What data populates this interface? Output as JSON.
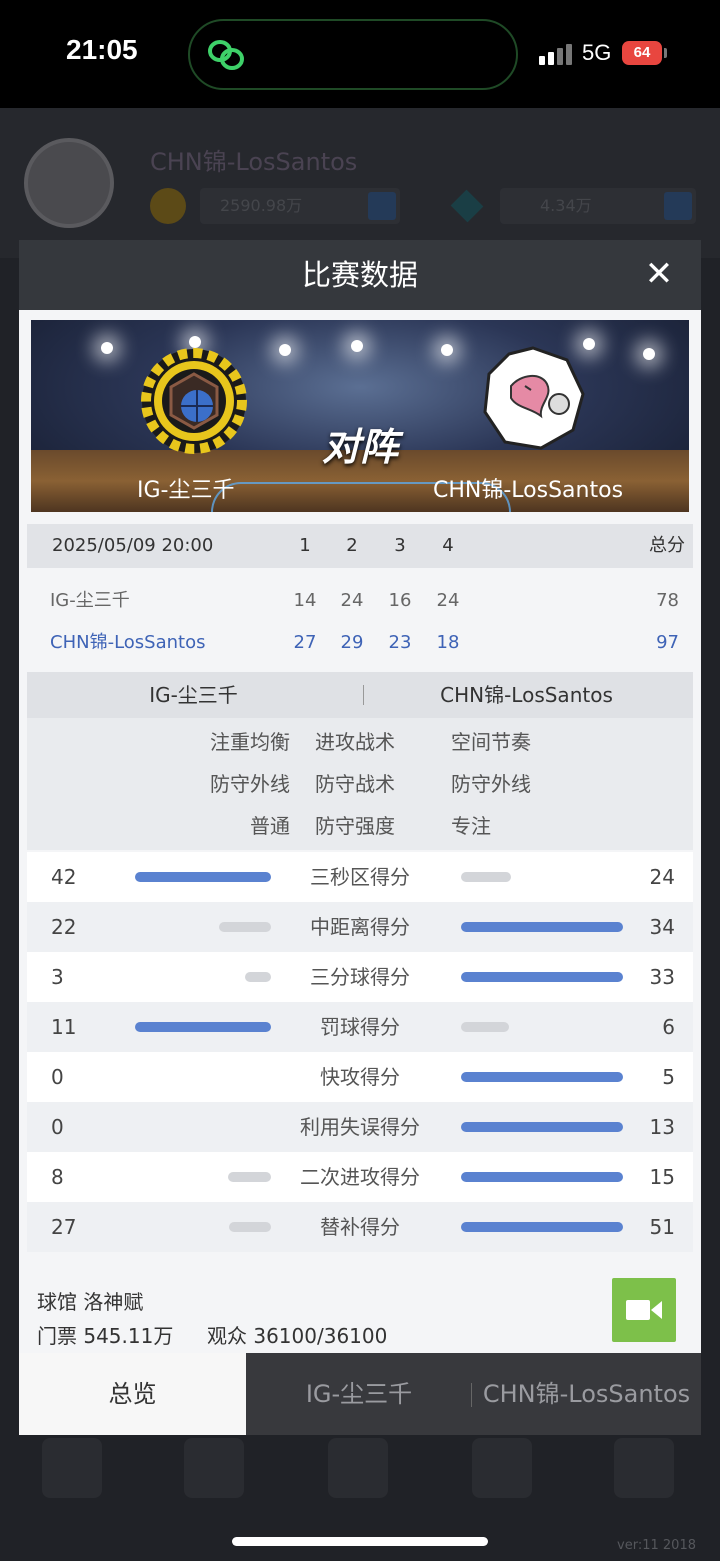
{
  "status_bar": {
    "time": "21:05",
    "network": "5G",
    "battery": "64"
  },
  "background": {
    "player_name": "CHN锦-LosSantos",
    "coins": "2590.98万",
    "gems": "4.34万",
    "version": "ver:11  2018"
  },
  "modal": {
    "title": "比赛数据",
    "close_icon": "close-icon",
    "banner": {
      "team_left": "IG-尘三千",
      "team_right": "CHN锦-LosSantos",
      "vs_text": "对阵"
    },
    "score_table": {
      "date": "2025/05/09 20:00",
      "quarter_labels": [
        "1",
        "2",
        "3",
        "4"
      ],
      "total_label": "总分",
      "rows": [
        {
          "team": "IG-尘三千",
          "quarters": [
            "14",
            "24",
            "16",
            "24"
          ],
          "total": "78"
        },
        {
          "team": "CHN锦-LosSantos",
          "quarters": [
            "27",
            "29",
            "23",
            "18"
          ],
          "total": "97"
        }
      ]
    },
    "tactics": {
      "team_left": "IG-尘三千",
      "team_right": "CHN锦-LosSantos",
      "rows": [
        [
          "注重均衡",
          "进攻战术",
          "空间节奏"
        ],
        [
          "防守外线",
          "防守战术",
          "防守外线"
        ],
        [
          "普通",
          "防守强度",
          "专注"
        ]
      ]
    },
    "stats": [
      {
        "label": "三秒区得分",
        "left": "42",
        "right": "24"
      },
      {
        "label": "中距离得分",
        "left": "22",
        "right": "34"
      },
      {
        "label": "三分球得分",
        "left": "3",
        "right": "33"
      },
      {
        "label": "罚球得分",
        "left": "11",
        "right": "6"
      },
      {
        "label": "快攻得分",
        "left": "0",
        "right": "5"
      },
      {
        "label": "利用失误得分",
        "left": "0",
        "right": "13"
      },
      {
        "label": "二次进攻得分",
        "left": "8",
        "right": "15"
      },
      {
        "label": "替补得分",
        "left": "27",
        "right": "51"
      }
    ],
    "venue": {
      "arena_line": "球馆 洛神赋",
      "tickets_line": "门票 545.11万",
      "audience_line": "观众 36100/36100",
      "video_icon": "video-camera-icon"
    },
    "tabs": [
      "总览",
      "IG-尘三千",
      "CHN锦-LosSantos"
    ]
  },
  "colors": {
    "win_bar": "#5a82d0",
    "lose_bar": "#d3d5d9",
    "team_b_text": "#3e63b6",
    "video_button": "#7dc04a"
  }
}
